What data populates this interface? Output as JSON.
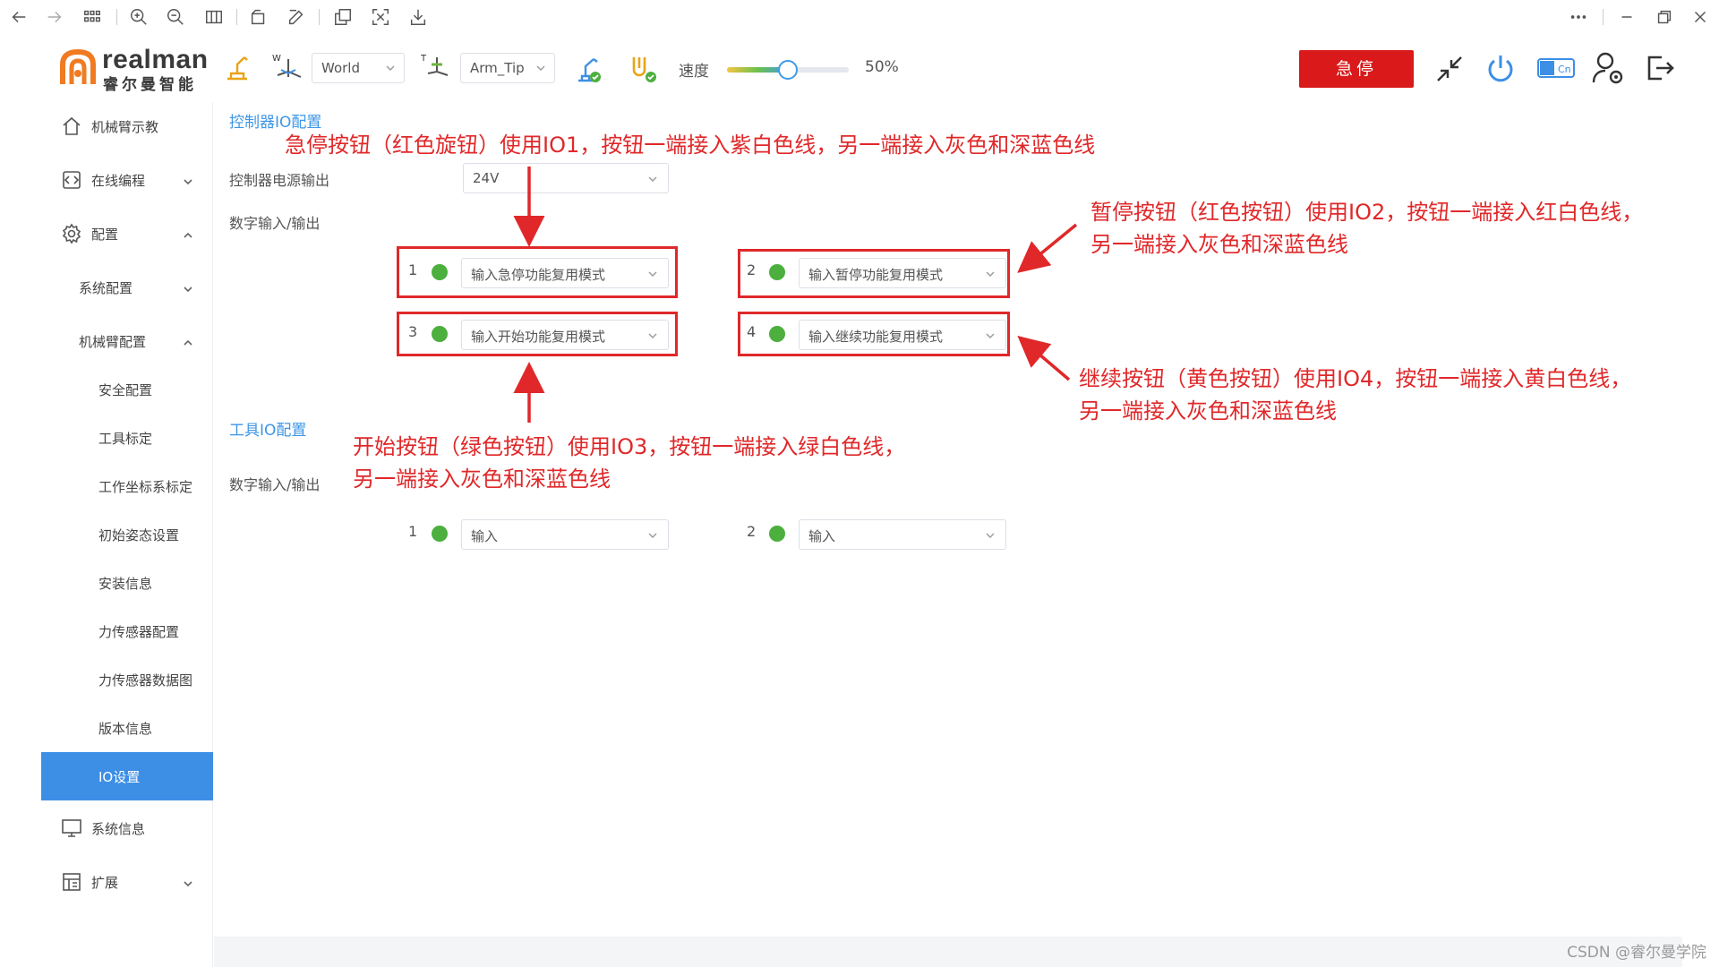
{
  "header": {
    "logo_en": "realman",
    "logo_cn": "睿尔曼智能",
    "frame_select": "World",
    "tool_select": "Arm_Tip",
    "speed_label": "速度",
    "speed_value": "50%",
    "speed_fraction": 0.5,
    "estop_label": "急停"
  },
  "sidebar": {
    "items": [
      {
        "label": "机械臂示教"
      },
      {
        "label": "在线编程"
      },
      {
        "label": "配置"
      },
      {
        "label": "系统配置"
      },
      {
        "label": "机械臂配置"
      },
      {
        "label": "安全配置"
      },
      {
        "label": "工具标定"
      },
      {
        "label": "工作坐标系标定"
      },
      {
        "label": "初始姿态设置"
      },
      {
        "label": "安装信息"
      },
      {
        "label": "力传感器配置"
      },
      {
        "label": "力传感器数据图"
      },
      {
        "label": "版本信息"
      },
      {
        "label": "IO设置"
      },
      {
        "label": "系统信息"
      },
      {
        "label": "扩展"
      }
    ]
  },
  "main": {
    "controller_title": "控制器IO配置",
    "power_label": "控制器电源输出",
    "power_value": "24V",
    "digital_label": "数字输入/输出",
    "controller_io": [
      {
        "num": "1",
        "mode": "输入急停功能复用模式"
      },
      {
        "num": "2",
        "mode": "输入暂停功能复用模式"
      },
      {
        "num": "3",
        "mode": "输入开始功能复用模式"
      },
      {
        "num": "4",
        "mode": "输入继续功能复用模式"
      }
    ],
    "tool_title": "工具IO配置",
    "tool_digital_label": "数字输入/输出",
    "tool_io": [
      {
        "num": "1",
        "mode": "输入"
      },
      {
        "num": "2",
        "mode": "输入"
      }
    ]
  },
  "annotations": {
    "estop": "急停按钮（红色旋钮）使用IO1，按钮一端接入紫白色线，另一端接入灰色和深蓝色线",
    "pause_l1": "暂停按钮（红色按钮）使用IO2，按钮一端接入红白色线，",
    "pause_l2": "另一端接入灰色和深蓝色线",
    "start_l1": "开始按钮（绿色按钮）使用IO3，按钮一端接入绿白色线，",
    "start_l2": "另一端接入灰色和深蓝色线",
    "continue_l1": "继续按钮（黄色按钮）使用IO4，按钮一端接入黄白色线，",
    "continue_l2": "另一端接入灰色和深蓝色线",
    "color": "#e0282a"
  },
  "watermark": "CSDN @睿尔曼学院"
}
